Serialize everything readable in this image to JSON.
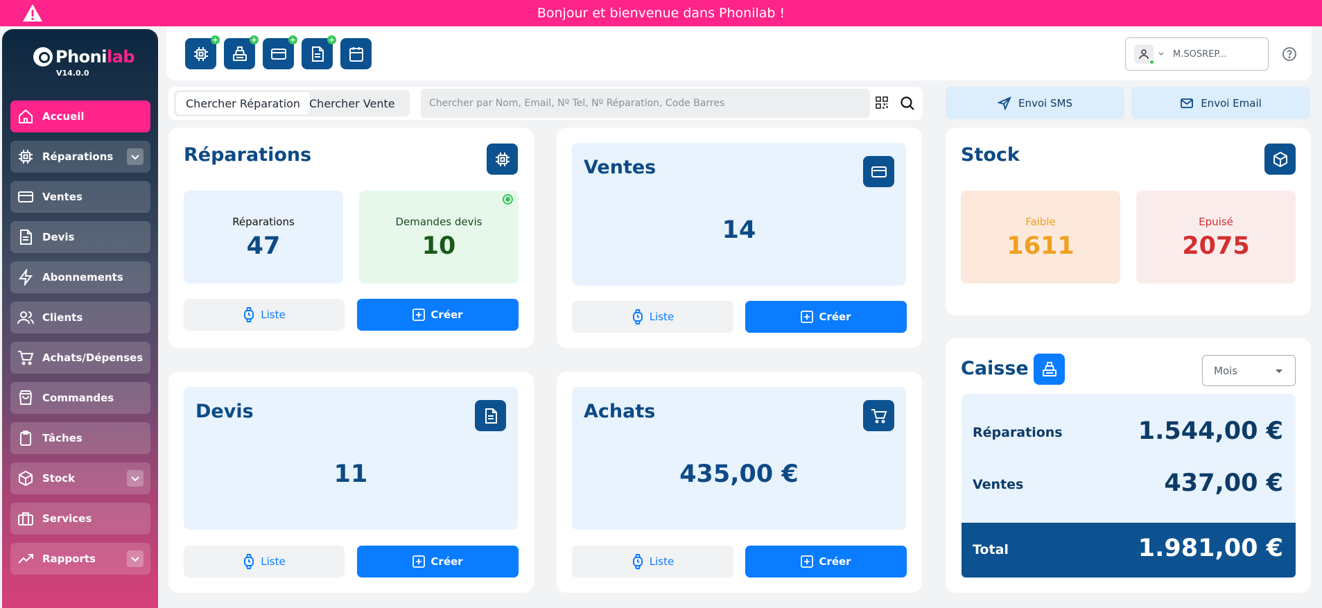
{
  "banner": {
    "message": "Bonjour et bienvenue dans Phonilab !",
    "icon": "warning-icon"
  },
  "brand": {
    "name_part1": "Phoni",
    "name_part2": "lab",
    "version": "V14.0.0"
  },
  "sidebar": {
    "items": [
      {
        "label": "Accueil",
        "icon": "home-icon",
        "active": true,
        "has_submenu": false
      },
      {
        "label": "Réparations",
        "icon": "chip-icon",
        "active": false,
        "has_submenu": true
      },
      {
        "label": "Ventes",
        "icon": "card-icon",
        "active": false,
        "has_submenu": false
      },
      {
        "label": "Devis",
        "icon": "document-icon",
        "active": false,
        "has_submenu": false
      },
      {
        "label": "Abonnements",
        "icon": "lightning-icon",
        "active": false,
        "has_submenu": false
      },
      {
        "label": "Clients",
        "icon": "users-icon",
        "active": false,
        "has_submenu": false
      },
      {
        "label": "Achats/Dépenses",
        "icon": "cart-icon",
        "active": false,
        "has_submenu": false
      },
      {
        "label": "Commandes",
        "icon": "bag-icon",
        "active": false,
        "has_submenu": false
      },
      {
        "label": "Tâches",
        "icon": "clipboard-icon",
        "active": false,
        "has_submenu": false
      },
      {
        "label": "Stock",
        "icon": "box-icon",
        "active": false,
        "has_submenu": true
      },
      {
        "label": "Services",
        "icon": "briefcase-icon",
        "active": false,
        "has_submenu": false
      },
      {
        "label": "Rapports",
        "icon": "trend-icon",
        "active": false,
        "has_submenu": true
      }
    ]
  },
  "toolbar": {
    "quick_buttons": [
      "new-repair",
      "new-cash-entry",
      "new-sale",
      "new-quote",
      "calendar"
    ],
    "user": {
      "name": "M.SOSREP..."
    }
  },
  "search": {
    "tabs": [
      "Chercher Réparation",
      "Chercher Vente"
    ],
    "active_tab": "Chercher Réparation",
    "placeholder": "Chercher par Nom, Email, Nº Tel, Nº Réparation, Code Barres",
    "value": ""
  },
  "actions": {
    "sms": "Envoi SMS",
    "email": "Envoi Email"
  },
  "common": {
    "liste": "Liste",
    "creer": "Créer"
  },
  "reparations": {
    "title": "Réparations",
    "count_label": "Réparations",
    "count": "47",
    "quotes_label": "Demandes devis",
    "quotes": "10"
  },
  "ventes": {
    "title": "Ventes",
    "value": "14"
  },
  "devis": {
    "title": "Devis",
    "value": "11"
  },
  "achats": {
    "title": "Achats",
    "value": "435,00 €"
  },
  "stock": {
    "title": "Stock",
    "low_label": "Faible",
    "low": "1611",
    "out_label": "Epuisé",
    "out": "2075"
  },
  "caisse": {
    "title": "Caisse",
    "period": "Mois",
    "rows": [
      {
        "label": "Réparations",
        "value": "1.544,00 €"
      },
      {
        "label": "Ventes",
        "value": "437,00 €"
      }
    ],
    "total_label": "Total",
    "total": "1.981,00 €"
  },
  "colors": {
    "brand_pink": "#ff2489",
    "primary_blue": "#0a7cff",
    "navy": "#0d5290",
    "stock_low": "#f0a020",
    "stock_out": "#d32f2f",
    "quotes_green": "#195a1a"
  }
}
